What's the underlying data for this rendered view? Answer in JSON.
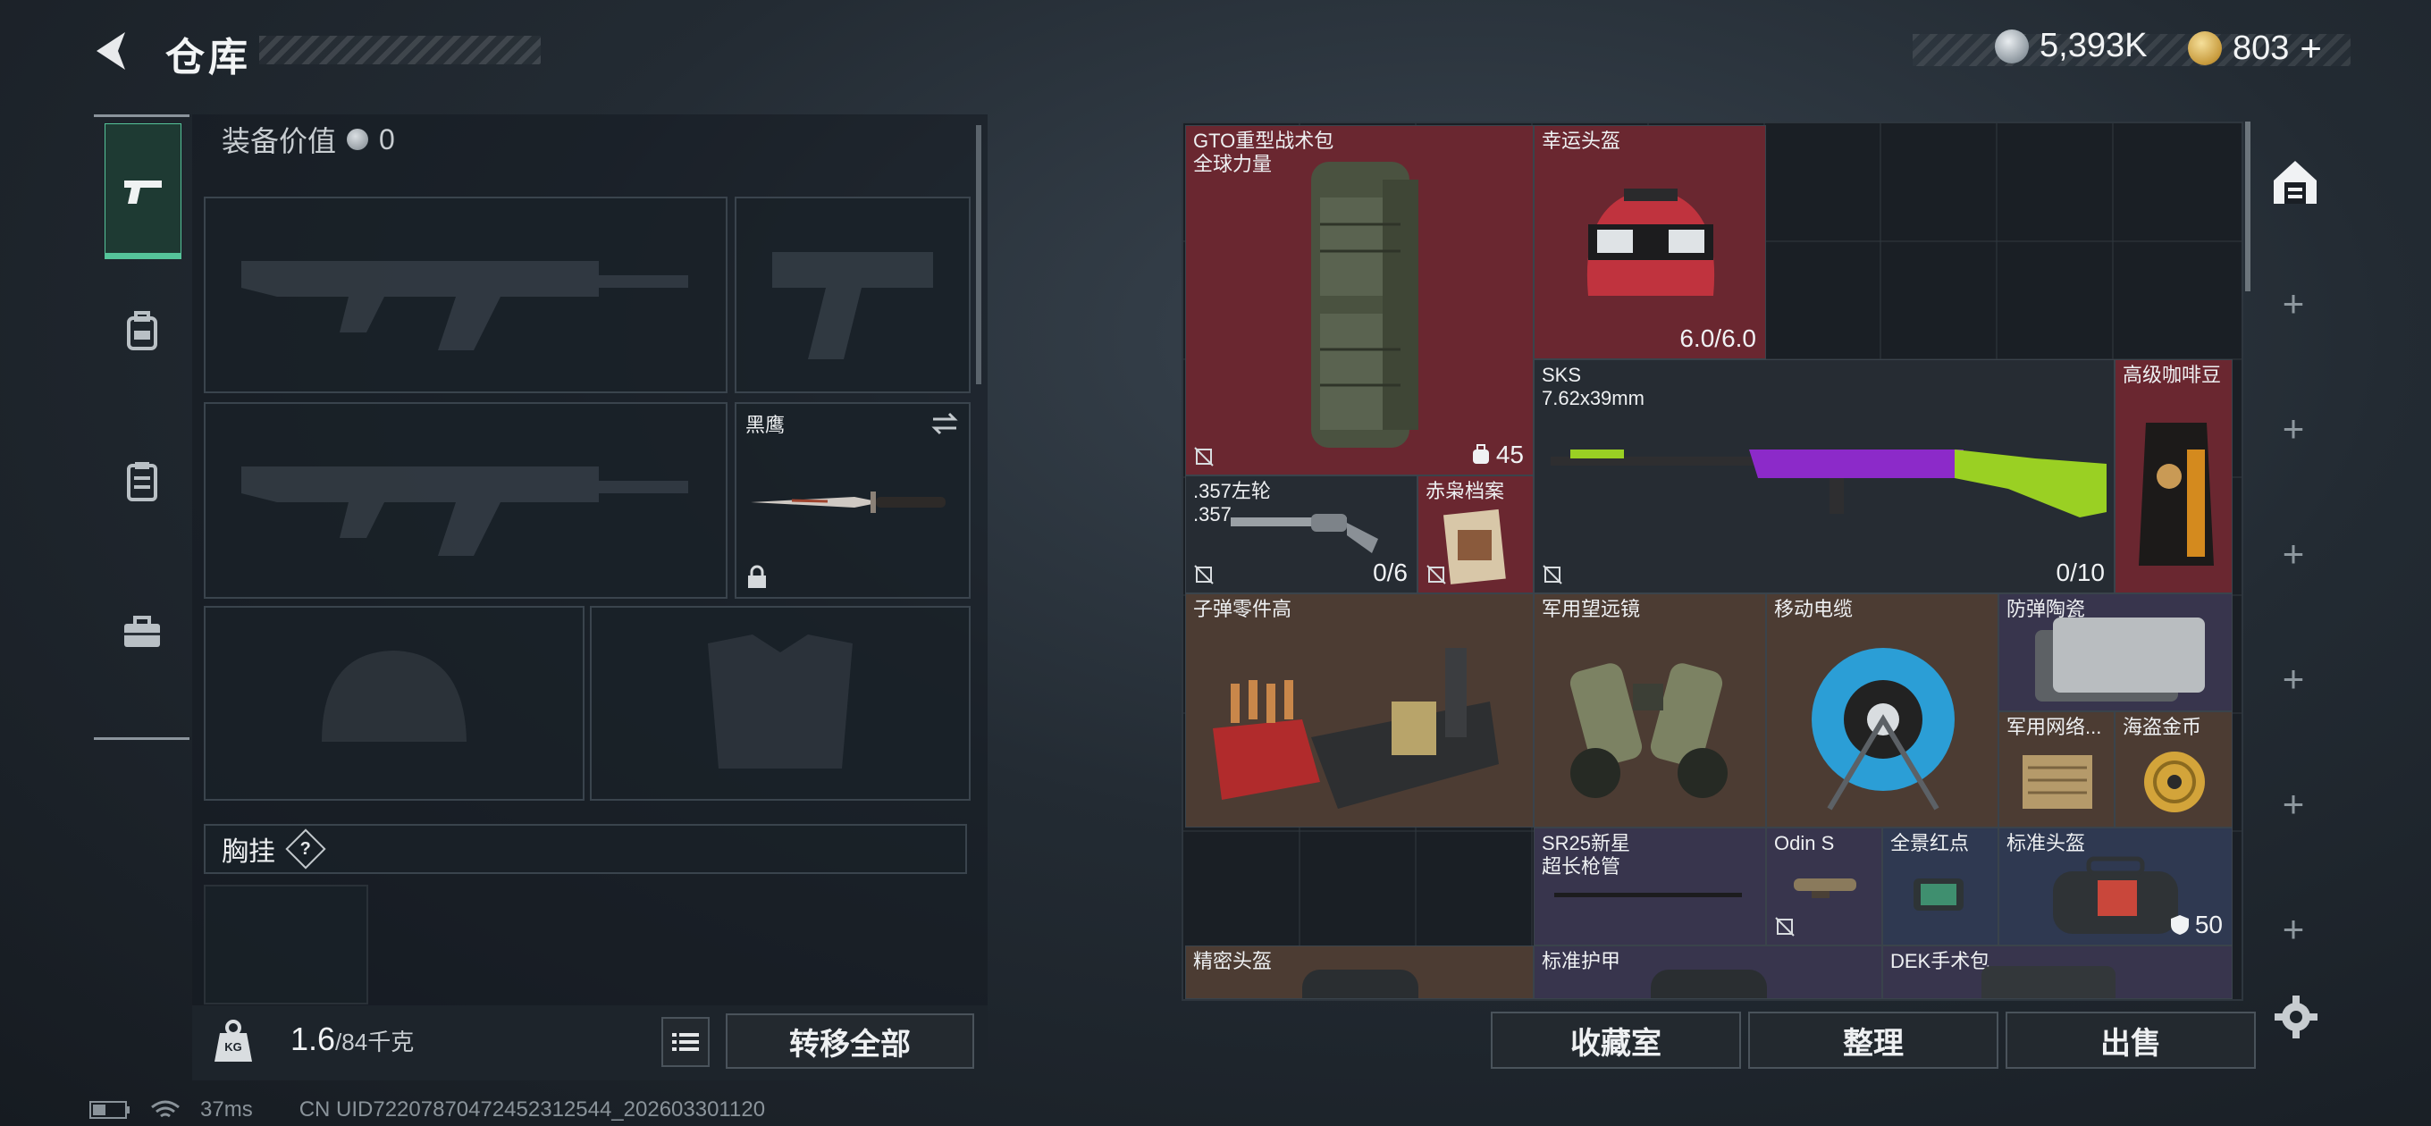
{
  "header": {
    "title": "仓库",
    "currencies": [
      {
        "icon": "silver-coin-icon",
        "value": "5,393K"
      },
      {
        "icon": "gold-triangle-coin-icon",
        "value": "803",
        "add": "+"
      }
    ]
  },
  "nav": {
    "items": [
      {
        "name": "weapons",
        "icon": "pistol-icon",
        "active": true
      },
      {
        "name": "backpack",
        "icon": "backpack-icon"
      },
      {
        "name": "vest",
        "icon": "clipboard-icon"
      },
      {
        "name": "toolbox",
        "icon": "toolbox-icon"
      }
    ]
  },
  "loadout": {
    "equip_value_label": "装备价值",
    "equip_value": "0",
    "melee_name": "黑鹰",
    "chest_rig_label": "胸挂",
    "help": "?",
    "weight_current": "1.6",
    "weight_max": "/84千克",
    "transfer_all": "转移全部",
    "weight_icon_text": "KG"
  },
  "stash": {
    "items": [
      {
        "key": "gto",
        "name": "GTO重型战术包",
        "sub": "全球力量",
        "count": "45",
        "color": "red"
      },
      {
        "key": "helmet",
        "name": "幸运头盔",
        "count": "6.0/6.0",
        "color": "red"
      },
      {
        "key": "sks",
        "name": "SKS",
        "sub": "7.62x39mm",
        "count": "0/10",
        "color": "empty"
      },
      {
        "key": "coffee",
        "name": "高级咖啡豆",
        "color": "red"
      },
      {
        "key": "revolver",
        "name": ".357左轮",
        "sub": ".357",
        "count": "0/6",
        "color": "empty"
      },
      {
        "key": "owl",
        "name": "赤枭档案",
        "color": "red"
      },
      {
        "key": "ammo",
        "name": "子弹零件高",
        "color": "brown"
      },
      {
        "key": "binoc",
        "name": "军用望远镜",
        "color": "brown"
      },
      {
        "key": "cable",
        "name": "移动电缆",
        "color": "brown"
      },
      {
        "key": "ceramic",
        "name": "防弹陶瓷",
        "color": "purple"
      },
      {
        "key": "netcard",
        "name": "军用网络...",
        "color": "brown"
      },
      {
        "key": "pirate",
        "name": "海盗金币",
        "color": "brown"
      },
      {
        "key": "sr25",
        "name": "SR25新星",
        "sub": "超长枪管",
        "color": "purple"
      },
      {
        "key": "odin",
        "name": "Odin S",
        "color": "purple"
      },
      {
        "key": "holo",
        "name": "全景红点",
        "color": "blue"
      },
      {
        "key": "stdhelm",
        "name": "标准头盔",
        "count": "50",
        "color": "blue"
      },
      {
        "key": "precision",
        "name": "精密头盔",
        "color": "brown"
      },
      {
        "key": "armor",
        "name": "标准护甲",
        "color": "purple"
      },
      {
        "key": "dek",
        "name": "DEK手术包",
        "color": "purple"
      }
    ],
    "buttons": {
      "collection": "收藏室",
      "sort": "整理",
      "sell": "出售"
    }
  },
  "footer": {
    "ping": "37ms",
    "uid": "CN UID72207870472452312544_202603301120"
  },
  "colors": {
    "accent": "#55c49a",
    "rarity_red": "#6a2730",
    "rarity_brown": "#4c3c33",
    "rarity_purple": "#38354d"
  }
}
